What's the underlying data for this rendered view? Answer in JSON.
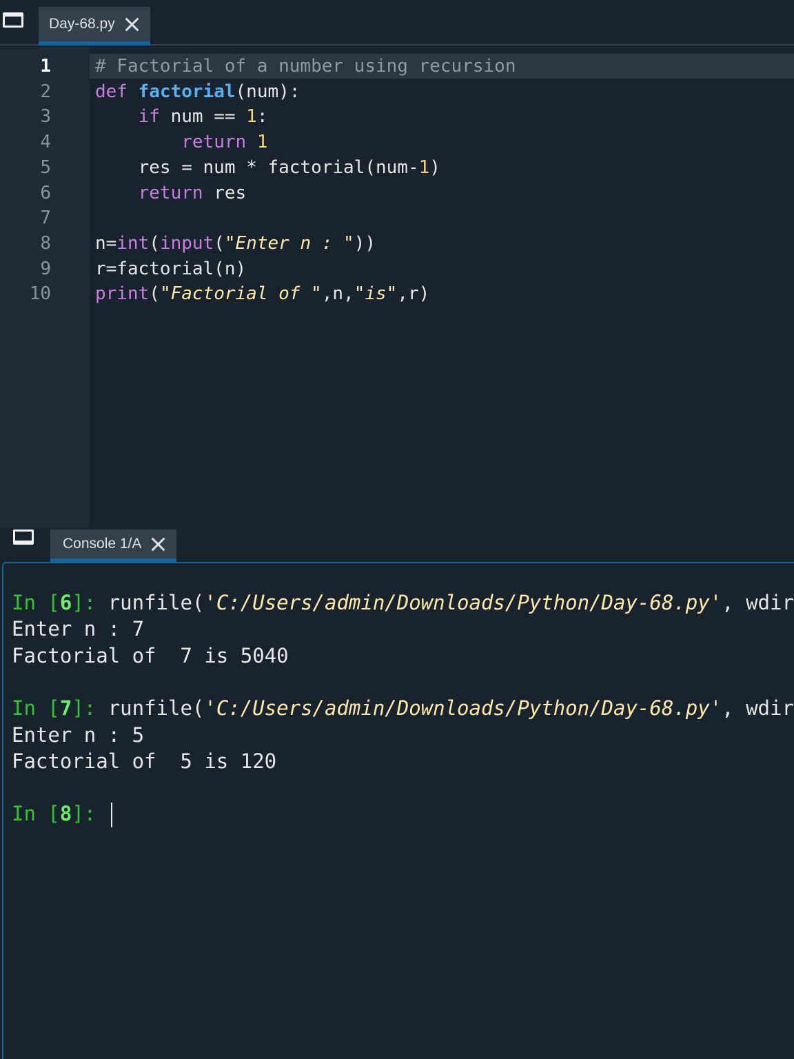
{
  "editor": {
    "tab": {
      "label": "Day-68.py"
    },
    "current_line": 1,
    "line_numbers": [
      "1",
      "2",
      "3",
      "4",
      "5",
      "6",
      "7",
      "8",
      "9",
      "10"
    ],
    "lines": [
      [
        {
          "t": "# Factorial of a number using recursion",
          "c": "comment"
        }
      ],
      [
        {
          "t": "def ",
          "c": "kw"
        },
        {
          "t": "factorial",
          "c": "fn"
        },
        {
          "t": "(num):",
          "c": "def"
        }
      ],
      [
        {
          "t": "    ",
          "c": "def"
        },
        {
          "t": "if",
          "c": "kw"
        },
        {
          "t": " num == ",
          "c": "def"
        },
        {
          "t": "1",
          "c": "num"
        },
        {
          "t": ":",
          "c": "def"
        }
      ],
      [
        {
          "t": "        ",
          "c": "def"
        },
        {
          "t": "return",
          "c": "kw"
        },
        {
          "t": " ",
          "c": "def"
        },
        {
          "t": "1",
          "c": "num"
        }
      ],
      [
        {
          "t": "    res = num * factorial(num-",
          "c": "def"
        },
        {
          "t": "1",
          "c": "num"
        },
        {
          "t": ")",
          "c": "def"
        }
      ],
      [
        {
          "t": "    ",
          "c": "def"
        },
        {
          "t": "return",
          "c": "kw"
        },
        {
          "t": " res",
          "c": "def"
        }
      ],
      [],
      [
        {
          "t": "n=",
          "c": "def"
        },
        {
          "t": "int",
          "c": "builtin"
        },
        {
          "t": "(",
          "c": "def"
        },
        {
          "t": "input",
          "c": "builtin"
        },
        {
          "t": "(",
          "c": "def"
        },
        {
          "t": "\"Enter n : \"",
          "c": "str"
        },
        {
          "t": "))",
          "c": "def"
        }
      ],
      [
        {
          "t": "r=factorial(n)",
          "c": "def"
        }
      ],
      [
        {
          "t": "print",
          "c": "builtin"
        },
        {
          "t": "(",
          "c": "def"
        },
        {
          "t": "\"Factorial of \"",
          "c": "str"
        },
        {
          "t": ",n,",
          "c": "def"
        },
        {
          "t": "\"is\"",
          "c": "str"
        },
        {
          "t": ",r)",
          "c": "def"
        }
      ]
    ]
  },
  "console": {
    "tab": {
      "label": "Console 1/A"
    },
    "lines": [
      {
        "kind": "prompt",
        "n": "6",
        "text": "runfile(",
        "path": "'C:/Users/admin/Downloads/Python/Day-68.py'",
        "rest": ", wdir="
      },
      {
        "kind": "out",
        "text": "Enter n : 7"
      },
      {
        "kind": "out",
        "text": "Factorial of  7 is 5040"
      },
      {
        "kind": "blank"
      },
      {
        "kind": "prompt",
        "n": "7",
        "text": "runfile(",
        "path": "'C:/Users/admin/Downloads/Python/Day-68.py'",
        "rest": ", wdir="
      },
      {
        "kind": "out",
        "text": "Enter n : 5"
      },
      {
        "kind": "out",
        "text": "Factorial of  5 is 120"
      },
      {
        "kind": "blank"
      },
      {
        "kind": "active_prompt",
        "n": "8"
      }
    ],
    "prompt_word": "In"
  }
}
